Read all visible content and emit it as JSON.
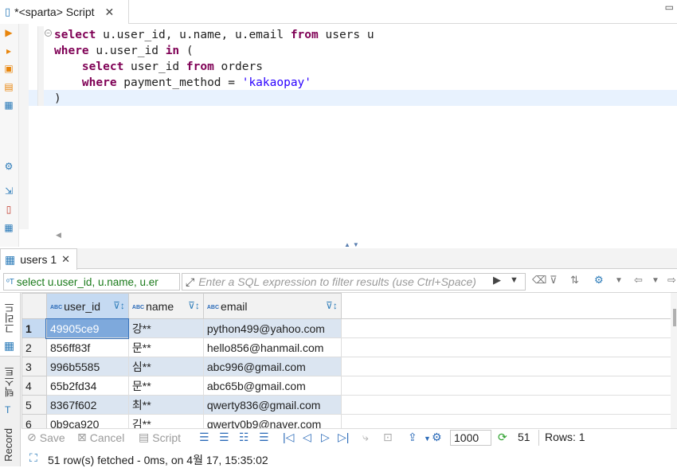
{
  "editor_tab": {
    "title": "*<sparta> Script"
  },
  "editor": {
    "lines": [
      [
        "kw:select",
        "t: u.user_id, u.name, u.email ",
        "kw:from",
        "t: users u"
      ],
      [
        "kw:where",
        "t: u.user_id ",
        "kw:in",
        "t: ("
      ],
      [
        "t:    ",
        "kw:select",
        "t: user_id ",
        "kw:from",
        "t: orders"
      ],
      [
        "t:    ",
        "kw:where",
        "t: payment_method = ",
        "str:'kakaopay'"
      ],
      [
        "t:)"
      ]
    ]
  },
  "result_tab": {
    "title": "users 1"
  },
  "filter": {
    "query_text": "select u.user_id, u.name, u.er",
    "placeholder": "Enter a SQL expression to filter results (use Ctrl+Space)"
  },
  "side_tabs": {
    "grid": "그리드",
    "text": "텍스트",
    "record": "Record"
  },
  "grid": {
    "columns": [
      {
        "type": "ABC",
        "name": "user_id"
      },
      {
        "type": "ABC",
        "name": "name"
      },
      {
        "type": "ABC",
        "name": "email"
      }
    ],
    "rows": [
      {
        "n": "1",
        "user_id": "49905ce9",
        "name": "강**",
        "email": "python499@yahoo.com"
      },
      {
        "n": "2",
        "user_id": "856ff83f",
        "name": "문**",
        "email": "hello856@hanmail.com"
      },
      {
        "n": "3",
        "user_id": "996b5585",
        "name": "심**",
        "email": "abc996@gmail.com"
      },
      {
        "n": "4",
        "user_id": "65b2fd34",
        "name": "문**",
        "email": "abc65b@gmail.com"
      },
      {
        "n": "5",
        "user_id": "8367f602",
        "name": "최**",
        "email": "qwerty836@gmail.com"
      },
      {
        "n": "6",
        "user_id": "0b9ca920",
        "name": "김**",
        "email": "qwerty0b9@naver.com"
      }
    ]
  },
  "bottom_toolbar": {
    "save": "Save",
    "cancel": "Cancel",
    "script": "Script",
    "fetch_size": "1000",
    "refresh_count": "51",
    "rows_label": "Rows: 1"
  },
  "status": {
    "text": "51 row(s) fetched - 0ms, on 4월 17, 15:35:02"
  }
}
